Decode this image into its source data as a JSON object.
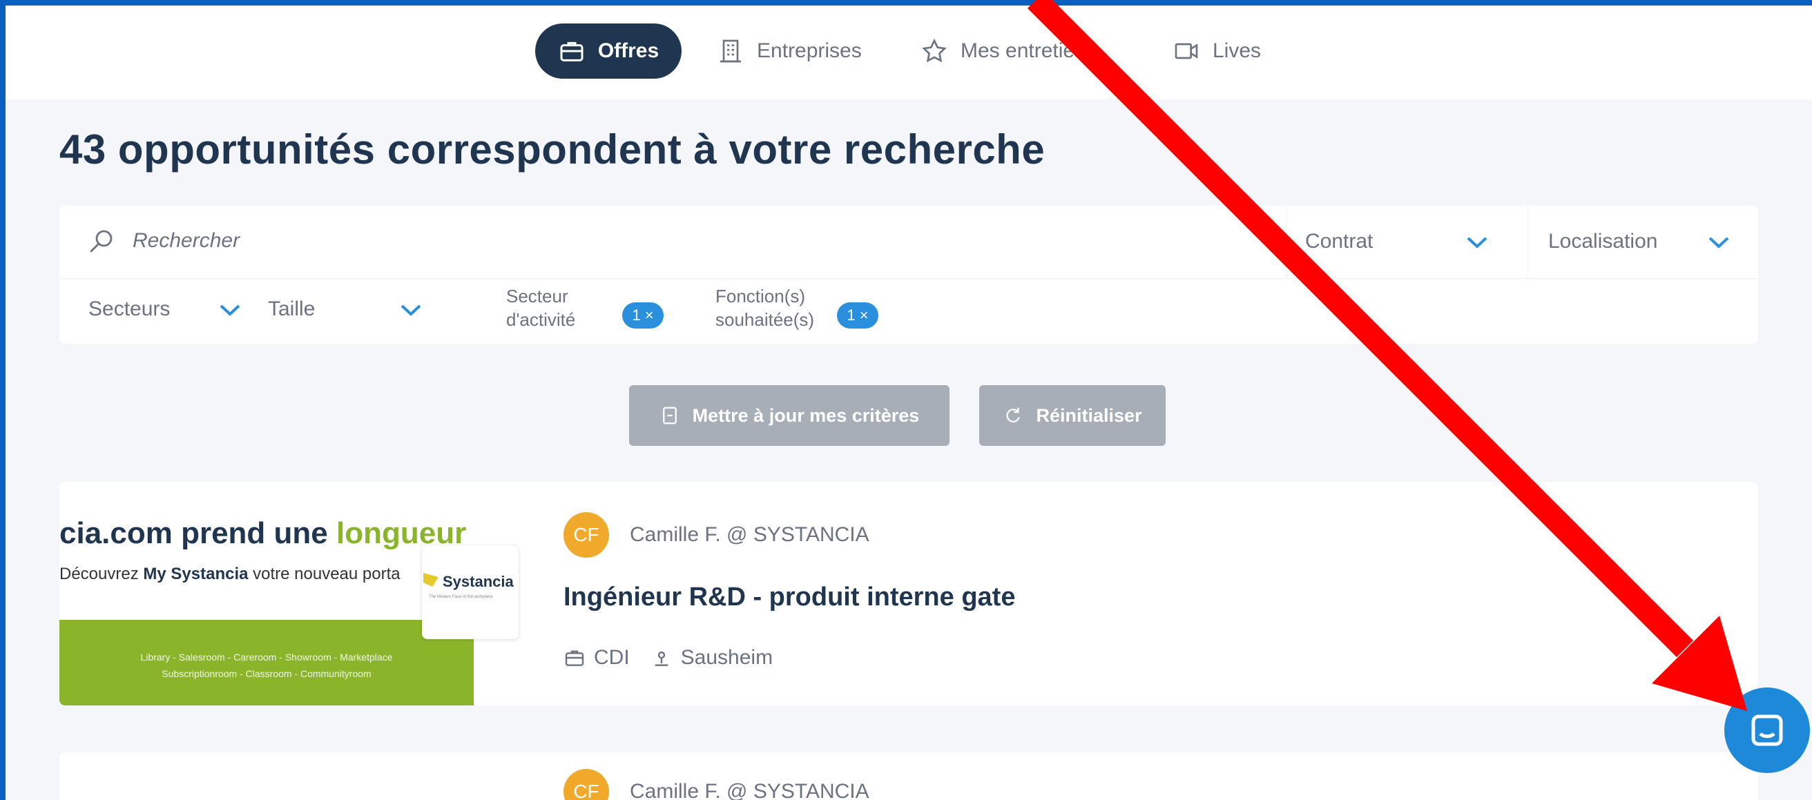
{
  "nav": {
    "offres": "Offres",
    "entreprises": "Entreprises",
    "entretiens": "Mes entretie",
    "lives": "Lives"
  },
  "headline": "43 opportunités correspondent à votre recherche",
  "filters": {
    "search_placeholder": "Rechercher",
    "contrat": "Contrat",
    "localisation": "Localisation",
    "secteurs": "Secteurs",
    "taille": "Taille",
    "secteur_activite_line1": "Secteur",
    "secteur_activite_line2": "d'activité",
    "secteur_activite_chip": "1 ×",
    "fonction_line1": "Fonction(s)",
    "fonction_line2": "souhaitée(s)",
    "fonction_chip": "1 ×"
  },
  "actions": {
    "update_label": "Mettre à jour mes critères",
    "reset_label": "Réinitialiser"
  },
  "jobs": [
    {
      "banner_title_a": "cia.com prend une ",
      "banner_title_b": "longueur d'avan",
      "banner_sub_a": "Découvrez ",
      "banner_sub_b": "My Systancia",
      "banner_sub_c": " votre nouveau porta",
      "banner_line1": "Library - Salesroom - Careroom - Showroom - Marketplace",
      "banner_line2": "Subscriptionroom - Classroom - Communityroom",
      "logo_text": "Systancia",
      "logo_tagline": "The Modern Face of the workplace",
      "avatar_initials": "CF",
      "recruiter": "Camille F. @ SYSTANCIA",
      "title": "Ingénieur R&D - produit interne gate",
      "contract": "CDI",
      "location": "Sausheim"
    },
    {
      "avatar_initials": "CF",
      "recruiter": "Camille F. @ SYSTANCIA"
    }
  ],
  "colors": {
    "nav_active": "#1f3550",
    "accent_blue": "#2a8fdd",
    "annotation_arrow": "#ff0000",
    "chat_bubble": "#1e88d9"
  }
}
